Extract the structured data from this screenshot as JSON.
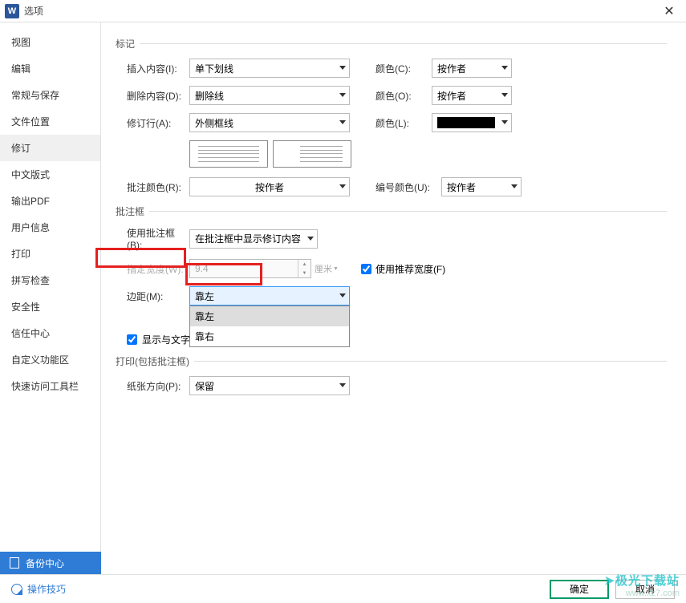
{
  "window": {
    "title": "选项",
    "app_letter": "W",
    "close": "✕"
  },
  "sidebar": {
    "items": [
      "视图",
      "编辑",
      "常规与保存",
      "文件位置",
      "修订",
      "中文版式",
      "输出PDF",
      "用户信息",
      "打印",
      "拼写检查",
      "安全性",
      "信任中心",
      "自定义功能区",
      "快速访问工具栏"
    ],
    "selected_index": 4,
    "backup_center": "备份中心"
  },
  "sections": {
    "mark": {
      "title": "标记",
      "insert_label": "插入内容(I):",
      "insert_value": "单下划线",
      "delete_label": "删除内容(D):",
      "delete_value": "删除线",
      "revline_label": "修订行(A):",
      "revline_value": "外侧框线",
      "color_c_label": "颜色(C):",
      "color_c_value": "按作者",
      "color_o_label": "颜色(O):",
      "color_o_value": "按作者",
      "color_l_label": "颜色(L):",
      "comment_color_label": "批注颜色(R):",
      "comment_color_value": "按作者",
      "number_color_label": "编号颜色(U):",
      "number_color_value": "按作者"
    },
    "balloon": {
      "title": "批注框",
      "use_label": "使用批注框(B):",
      "use_value": "在批注框中显示修订内容",
      "width_label": "指定宽度(W):",
      "width_value": "9.4",
      "width_unit": "厘米",
      "rec_width_label": "使用推荐宽度(F)",
      "rec_width_checked": true,
      "margin_label": "边距(M):",
      "margin_value": "靠左",
      "margin_options": [
        "靠左",
        "靠右"
      ],
      "show_conn_label": "显示与文字的连线(S)",
      "show_conn_checked": true
    },
    "print": {
      "title": "打印(包括批注框)",
      "orient_label": "纸张方向(P):",
      "orient_value": "保留"
    }
  },
  "footer": {
    "tips": "操作技巧",
    "ok": "确定",
    "cancel": "取消"
  },
  "watermark": {
    "line1": "➤极光下载站",
    "line2": "www.xz7.com"
  }
}
